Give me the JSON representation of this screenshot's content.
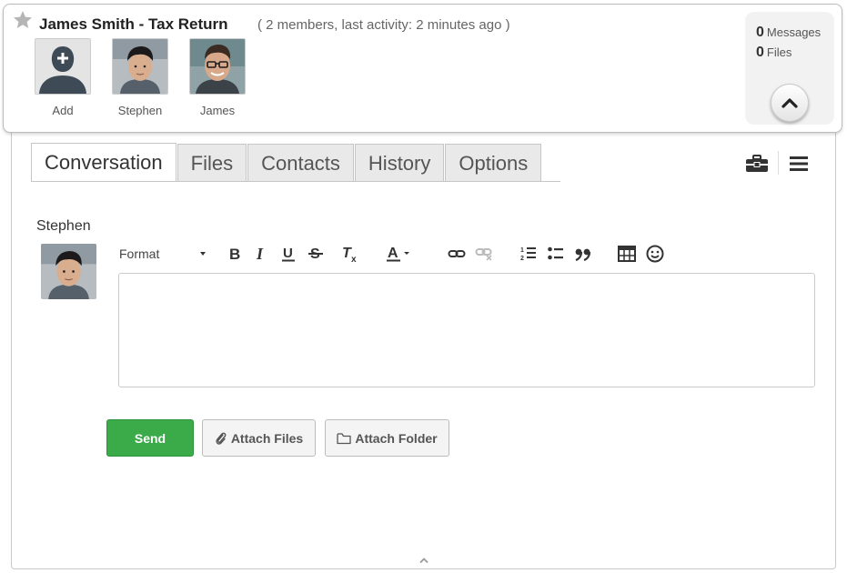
{
  "header": {
    "title": "James Smith - Tax Return",
    "meta": "( 2 members, last activity: 2 minutes ago )",
    "members": [
      {
        "label": "Add"
      },
      {
        "label": "Stephen"
      },
      {
        "label": "James"
      }
    ],
    "stats": {
      "messages_count": "0",
      "messages_label": "Messages",
      "files_count": "0",
      "files_label": "Files"
    }
  },
  "tabs": [
    {
      "label": "Conversation",
      "active": true
    },
    {
      "label": "Files"
    },
    {
      "label": "Contacts"
    },
    {
      "label": "History"
    },
    {
      "label": "Options"
    }
  ],
  "composer": {
    "author": "Stephen",
    "format_label": "Format",
    "send_label": "Send",
    "attach_files_label": "Attach Files",
    "attach_folder_label": "Attach Folder"
  },
  "icons": [
    "star-icon",
    "add-member-icon",
    "chevron-up-icon",
    "toolbox-icon",
    "menu-icon",
    "bold-icon",
    "italic-icon",
    "underline-icon",
    "strikethrough-icon",
    "clear-format-icon",
    "text-color-icon",
    "link-icon",
    "unlink-icon",
    "numbered-list-icon",
    "bullet-list-icon",
    "blockquote-icon",
    "table-icon",
    "emoji-icon",
    "paperclip-icon",
    "folder-icon"
  ],
  "colors": {
    "send_green": "#3bab4a",
    "tab_inactive": "#e9e9e9",
    "stats_bg": "#f2f2f2"
  }
}
